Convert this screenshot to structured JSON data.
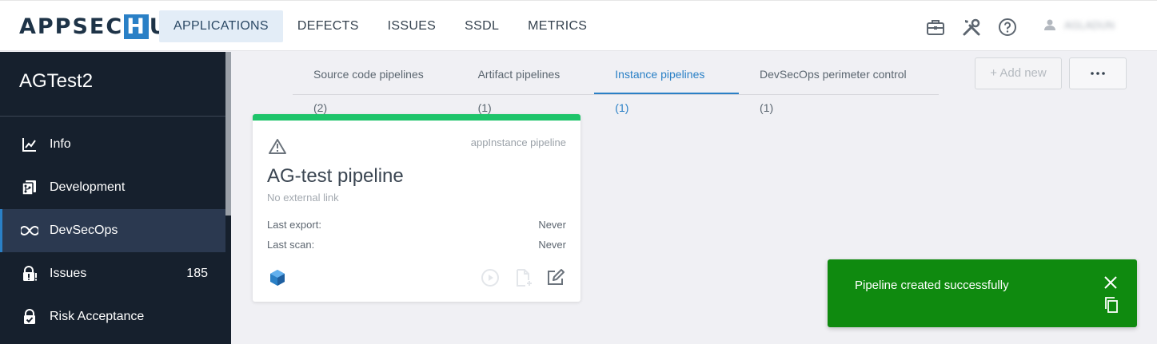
{
  "header": {
    "logo_prefix": "APPSEC",
    "logo_h": "H",
    "logo_suffix": "UB",
    "nav": [
      {
        "label": "APPLICATIONS"
      },
      {
        "label": "DEFECTS"
      },
      {
        "label": "ISSUES"
      },
      {
        "label": "SSDL"
      },
      {
        "label": "METRICS"
      }
    ],
    "active_nav": "APPLICATIONS",
    "icons": [
      "briefcase-icon",
      "tools-icon",
      "help-icon",
      "user-icon"
    ],
    "user_name": "AGLADUN"
  },
  "sidebar": {
    "title": "AGTest2",
    "items": [
      {
        "label": "Info",
        "icon": "chart-line-icon"
      },
      {
        "label": "Development",
        "icon": "code-branch-icon"
      },
      {
        "label": "DevSecOps",
        "icon": "infinity-icon",
        "active": true
      },
      {
        "label": "Issues",
        "icon": "lock-alert-icon",
        "count": "185"
      },
      {
        "label": "Risk Acceptance",
        "icon": "lock-check-icon"
      }
    ]
  },
  "tabs": [
    {
      "label": "Source code pipelines (2)"
    },
    {
      "label": "Artifact pipelines (1)"
    },
    {
      "label": "Instance pipelines (1)",
      "active": true
    },
    {
      "label": "DevSecOps perimeter control (1)"
    }
  ],
  "toolbar": {
    "add_label": "+ Add new",
    "more_label": "•••"
  },
  "card": {
    "status_color": "#1ec46a",
    "type": "appInstance pipeline",
    "title": "AG-test pipeline",
    "subtitle": "No external link",
    "last_export_label": "Last export:",
    "last_export_value": "Never",
    "last_scan_label": "Last scan:",
    "last_scan_value": "Never",
    "icons": [
      "cube-icon",
      "play-icon",
      "file-add-icon",
      "edit-icon",
      "warning-icon"
    ]
  },
  "toast": {
    "message": "Pipeline created successfully",
    "color": "#0f8a0f"
  },
  "colors": {
    "accent": "#2a80c6",
    "sidebar_bg": "#16202d",
    "sidebar_active": "#2b3950"
  }
}
